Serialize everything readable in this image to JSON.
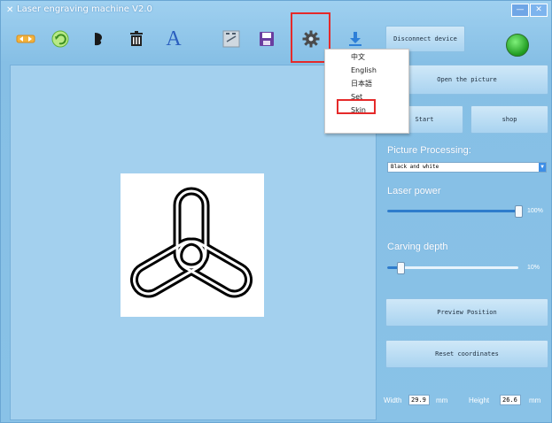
{
  "window": {
    "title": "Laser engraving machine V2.0",
    "minimize": "—",
    "close": "✕"
  },
  "toolbar": {
    "items": [
      {
        "name": "resize-icon"
      },
      {
        "name": "rotate-icon"
      },
      {
        "name": "invert-icon"
      },
      {
        "name": "trash-icon"
      },
      {
        "name": "text-icon",
        "label": "A"
      },
      {
        "name": "size-icon"
      },
      {
        "name": "save-icon"
      },
      {
        "name": "gear-icon"
      },
      {
        "name": "download-icon"
      }
    ]
  },
  "language_menu": {
    "items": [
      "中文",
      "English",
      "日本語",
      "Set",
      "Skin"
    ],
    "highlighted": "Set"
  },
  "panel": {
    "disconnect_label": "Disconnect device",
    "open_picture_label": "Open the picture",
    "start_label": "Start",
    "shop_label": "shop",
    "picture_processing_label": "Picture Processing:",
    "processing_selected": "Black and white",
    "laser_power_label": "Laser power",
    "laser_power_value": "100%",
    "laser_power_level": 1.0,
    "carving_depth_label": "Carving depth",
    "carving_depth_value": "10%",
    "carving_depth_level": 0.1,
    "preview_position_label": "Preview Position",
    "reset_coordinates_label": "Reset coordinates",
    "width_label": "Width",
    "width_value": "29.9",
    "width_unit": "mm",
    "height_label": "Height",
    "height_value": "26.6",
    "height_unit": "mm"
  },
  "colors": {
    "accent": "#2e7ccc",
    "highlight_red": "#e52a2a",
    "status_green": "#1f9b20",
    "background": "#8ec3e6"
  }
}
